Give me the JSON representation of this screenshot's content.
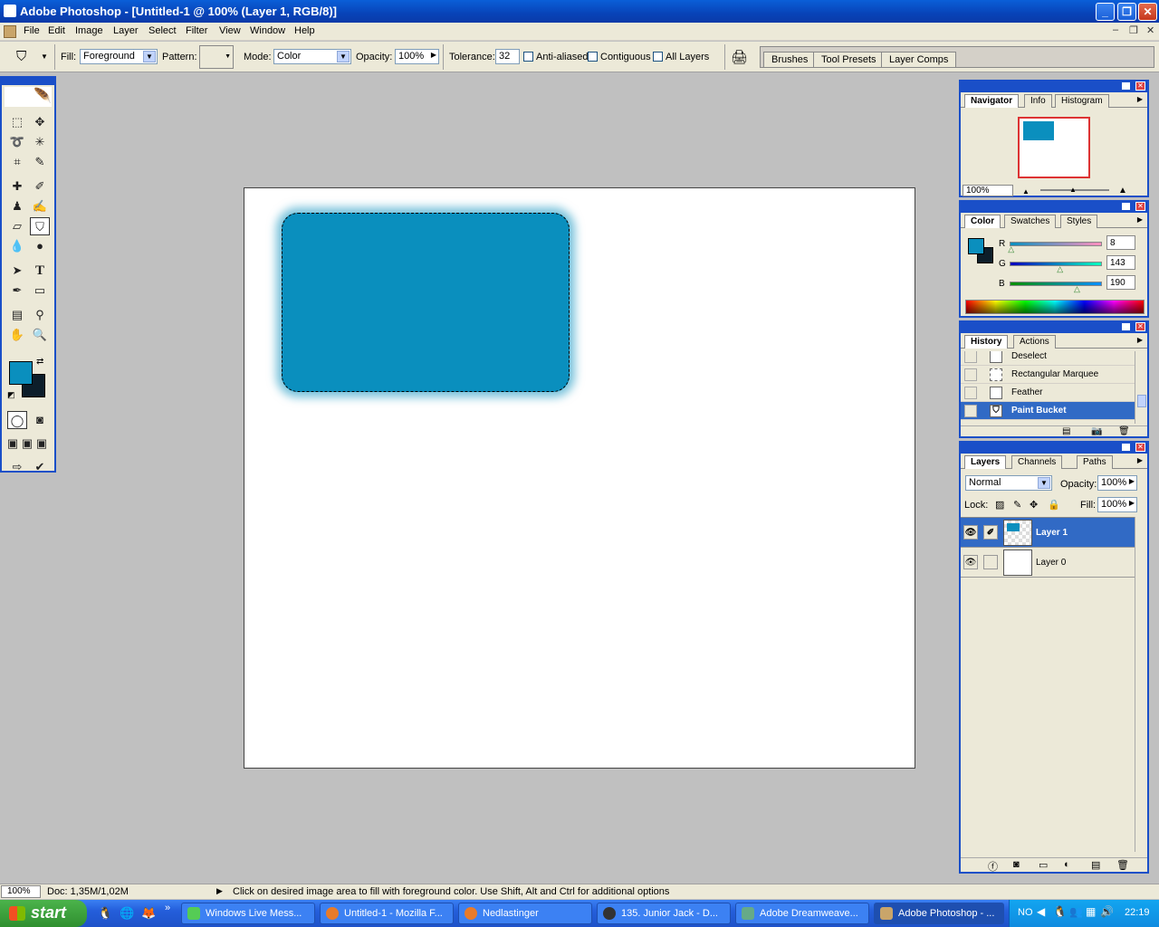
{
  "window": {
    "title": "Adobe Photoshop - [Untitled-1 @ 100% (Layer 1, RGB/8)]",
    "min": "_",
    "max": "❐",
    "close": "✕"
  },
  "menu": [
    "File",
    "Edit",
    "Image",
    "Layer",
    "Select",
    "Filter",
    "View",
    "Window",
    "Help"
  ],
  "options": {
    "fill_label": "Fill:",
    "fill_value": "Foreground",
    "pattern_label": "Pattern:",
    "mode_label": "Mode:",
    "mode_value": "Color",
    "opacity_label": "Opacity:",
    "opacity_value": "100%",
    "tolerance_label": "Tolerance:",
    "tolerance_value": "32",
    "anti_aliased": "Anti-aliased",
    "contiguous": "Contiguous",
    "all_layers": "All Layers",
    "well_tabs": [
      "Brushes",
      "Tool Presets",
      "Layer Comps"
    ]
  },
  "colors": {
    "foreground": "#0a8fbe",
    "background": "#0d1e2a"
  },
  "navigator": {
    "tabs": [
      "Navigator",
      "Info",
      "Histogram"
    ],
    "zoom": "100%"
  },
  "color_panel": {
    "tabs": [
      "Color",
      "Swatches",
      "Styles"
    ],
    "r_label": "R",
    "r": "8",
    "g_label": "G",
    "g": "143",
    "b_label": "B",
    "b": "190"
  },
  "history": {
    "tabs": [
      "History",
      "Actions"
    ],
    "items": [
      "Deselect",
      "Rectangular Marquee",
      "Feather",
      "Paint Bucket"
    ]
  },
  "layers": {
    "tabs": [
      "Layers",
      "Channels",
      "Paths"
    ],
    "blend": "Normal",
    "opacity_label": "Opacity:",
    "opacity": "100%",
    "lock_label": "Lock:",
    "fill_label": "Fill:",
    "fill": "100%",
    "items": [
      "Layer 1",
      "Layer 0"
    ]
  },
  "status": {
    "zoom": "100%",
    "doc": "Doc: 1,35M/1,02M",
    "hint": "Click on desired image area to fill with foreground color.  Use Shift, Alt and Ctrl for additional options"
  },
  "taskbar": {
    "start": "start",
    "tasks": [
      "Windows Live Mess...",
      "Untitled-1 - Mozilla F...",
      "Nedlastinger",
      "135. Junior Jack - D...",
      "Adobe Dreamweave...",
      "Adobe Photoshop - ..."
    ],
    "lang": "NO",
    "clock": "22:19"
  }
}
